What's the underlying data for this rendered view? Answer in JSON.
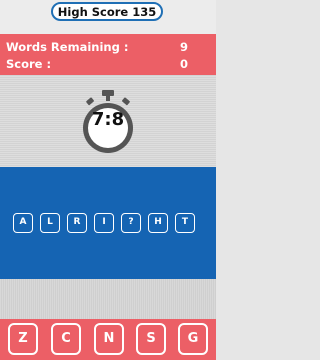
{
  "high_score": {
    "label": "High Score 135"
  },
  "stats": {
    "words_remaining_label": "Words Remaining :",
    "words_remaining_value": "9",
    "score_label": "Score :",
    "score_value": "0"
  },
  "timer": {
    "icon": "stopwatch-icon",
    "text": "7:8"
  },
  "word_tiles": [
    "A",
    "L",
    "R",
    "I",
    "?",
    "H",
    "T"
  ],
  "keys": [
    "Z",
    "C",
    "N",
    "S",
    "G"
  ],
  "colors": {
    "red_band": "#ec5f66",
    "blue_band": "#1564b3",
    "high_score_border": "#1f6fb5"
  }
}
